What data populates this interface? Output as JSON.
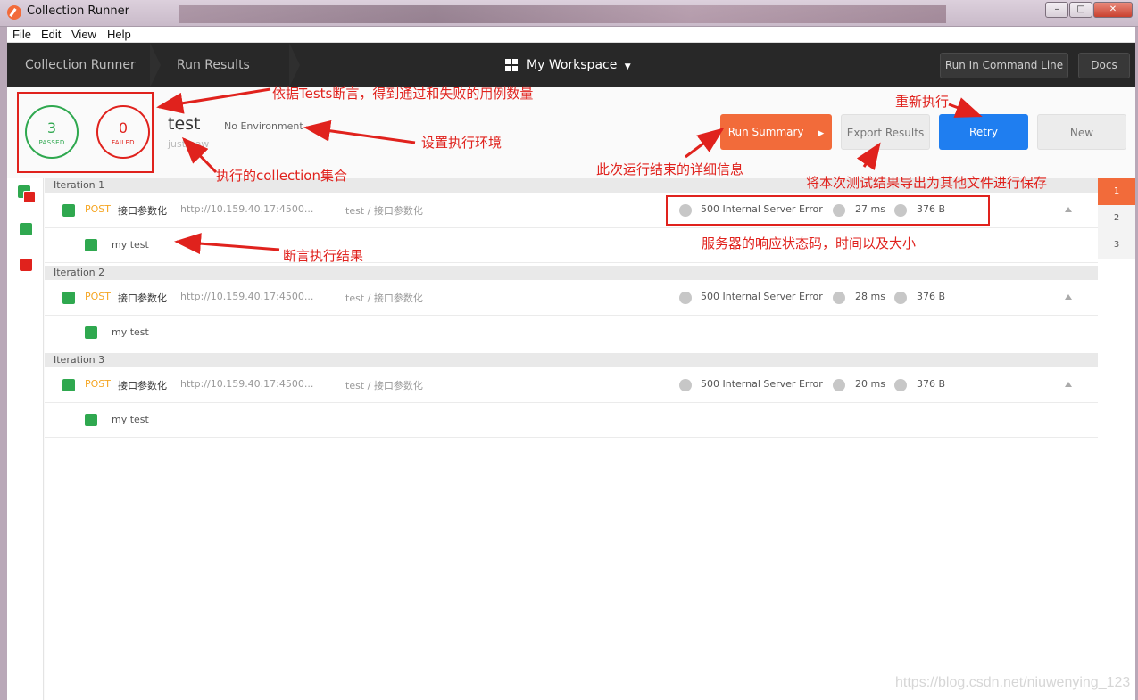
{
  "window": {
    "title": "Collection Runner"
  },
  "menu": {
    "items": [
      "File",
      "Edit",
      "View",
      "Help"
    ]
  },
  "header": {
    "crumbs": [
      "Collection Runner",
      "Run Results"
    ],
    "workspace": "My Workspace",
    "run_cli": "Run In Command Line",
    "docs": "Docs"
  },
  "summary": {
    "passed": {
      "count": "3",
      "label": "PASSED"
    },
    "failed": {
      "count": "0",
      "label": "FAILED"
    },
    "name": "test",
    "time": "just now",
    "environment": "No Environment",
    "buttons": {
      "run_summary": "Run Summary",
      "export": "Export Results",
      "retry": "Retry",
      "new": "New"
    }
  },
  "iterations": [
    {
      "label": "Iteration 1",
      "method": "POST",
      "name": "接口参数化",
      "url": "http://10.159.40.17:4500...",
      "path": "test / 接口参数化",
      "status": "500 Internal Server Error",
      "time": "27 ms",
      "size": "376 B",
      "test": "my test"
    },
    {
      "label": "Iteration 2",
      "method": "POST",
      "name": "接口参数化",
      "url": "http://10.159.40.17:4500...",
      "path": "test / 接口参数化",
      "status": "500 Internal Server Error",
      "time": "28 ms",
      "size": "376 B",
      "test": "my test"
    },
    {
      "label": "Iteration 3",
      "method": "POST",
      "name": "接口参数化",
      "url": "http://10.159.40.17:4500...",
      "path": "test / 接口参数化",
      "status": "500 Internal Server Error",
      "time": "20 ms",
      "size": "376 B",
      "test": "my test"
    }
  ],
  "pages": [
    "1",
    "2",
    "3"
  ],
  "annotations": {
    "counts": "依据Tests断言，得到通过和失败的用例数量",
    "env": "设置执行环境",
    "collection": "执行的collection集合",
    "summary": "此次运行结束的详细信息",
    "retry": "重新执行",
    "export": "将本次测试结果导出为其他文件进行保存",
    "assert": "断言执行结果",
    "response": "服务器的响应状态码，时间以及大小"
  },
  "watermark": "https://blog.csdn.net/niuwenying_123",
  "colors": {
    "accent": "#f26b3a",
    "pass": "#2fa84f",
    "fail": "#e0221d",
    "retry": "#1f7ef0",
    "annotation": "#e0221d"
  }
}
